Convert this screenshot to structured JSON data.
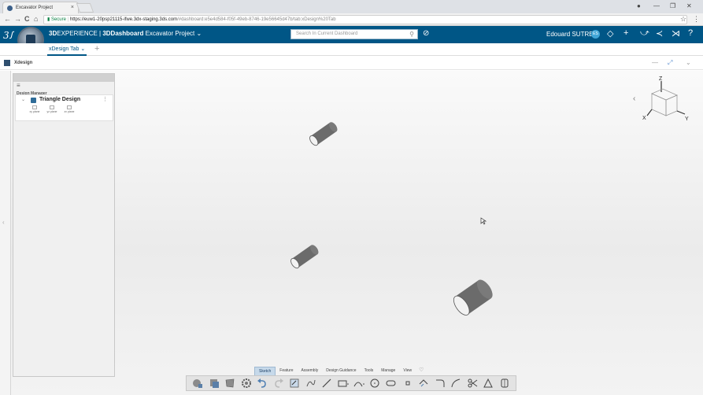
{
  "browser": {
    "tab_title": "Excavator Project",
    "tab_close": "×",
    "nav_back": "←",
    "nav_forward": "→",
    "nav_reload": "C",
    "nav_home": "⌂",
    "url_secure": "Secure",
    "url_host": "https://euw1-20psp21115-ifwe.3dx-staging.3ds.com",
    "url_path": "/#dashboard:e5e4d584-f05f-49eb-8746-19e56645d47b/tab:xDesign%20Tab",
    "star_icon": "☆",
    "menu_icon": "⋮",
    "win_account": "●",
    "win_min": "—",
    "win_max": "❐",
    "win_close": "✕"
  },
  "header": {
    "logo": "3ꭍ",
    "title_bold_prefix": "3D",
    "title_mid": "EXPERIENCE | ",
    "title_bold": "3DDashboard",
    "title_rest": " Excavator Project ⌄",
    "search_placeholder": "Search In Current Dashboard",
    "search_icon": "⚲",
    "tag_icon": "⊘",
    "user_name": "Edouard SUTRE",
    "user_initials": "ES",
    "icons": [
      "◇",
      "+",
      "⤻",
      "≺",
      "⋊",
      "?"
    ]
  },
  "dashboard": {
    "active_tab": "xDesign Tab ⌄",
    "add_tab": "+"
  },
  "panel": {
    "title": "Xdesign",
    "minimize": "—",
    "expand": "⤢",
    "collapse": "⌄",
    "left_chevron": "‹"
  },
  "design_manager": {
    "toolbar_icon": "≡",
    "label": "Design Manager",
    "expand_icon": "⌄",
    "item_name": "Triangle Design",
    "kebab": "⋮",
    "planes": [
      "xy plane",
      "yz plane",
      "zx plane"
    ]
  },
  "orientation": {
    "back_icon": "‹",
    "axis_z": "Z",
    "axis_x": "X",
    "axis_y": "Y"
  },
  "action_bar": {
    "tabs": [
      "Sketch",
      "Feature",
      "Assembly",
      "Design Guidance",
      "Tools",
      "Manage",
      "View"
    ],
    "more_icon": "♡",
    "icons": [
      "part-icon",
      "layers-icon",
      "shape-icon",
      "gear-icon",
      "undo-icon",
      "redo-icon",
      "sketch-icon",
      "spline-icon",
      "line-icon",
      "rectangle-icon",
      "arc-icon",
      "circle-icon",
      "slot-icon",
      "point-icon",
      "offset-icon",
      "fillet-icon",
      "corner-icon",
      "trim-icon",
      "triangle-icon",
      "extrude-icon"
    ]
  },
  "colors": {
    "brand": "#005686",
    "active_tab": "#c6d9ea",
    "cylinder": "#6b6b6b"
  }
}
